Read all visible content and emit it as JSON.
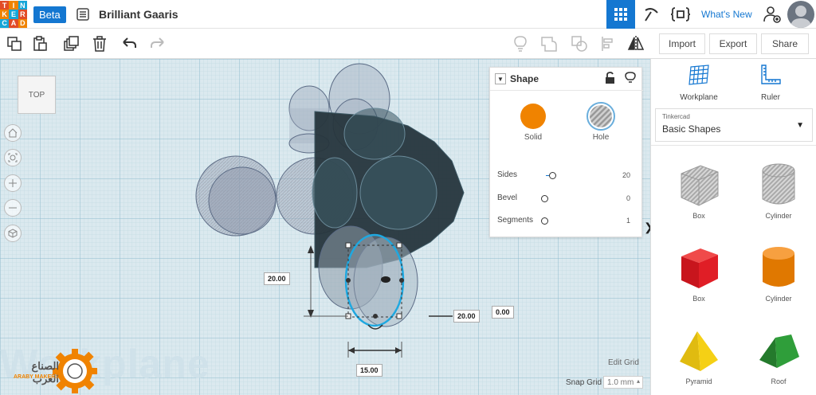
{
  "app": {
    "logo_letters": [
      "T",
      "I",
      "N",
      "K",
      "E",
      "R",
      "C",
      "A",
      "D"
    ],
    "badge": "Beta",
    "project_title": "Brilliant Gaaris"
  },
  "topbar": {
    "whats_new": "What's New"
  },
  "toolbar": {
    "import": "Import",
    "export": "Export",
    "share": "Share"
  },
  "canvas": {
    "view_label": "TOP",
    "workplane_text": "Workplane",
    "watermark": "الصناع العرب",
    "watermark_sub": "ARABY MAKERS"
  },
  "dimensions": {
    "height": "20.00",
    "offset_x": "20.00",
    "offset_y": "0.00",
    "width": "15.00"
  },
  "shape_panel": {
    "title": "Shape",
    "solid": "Solid",
    "hole": "Hole",
    "params": [
      {
        "label": "Sides",
        "value": "20"
      },
      {
        "label": "Bevel",
        "value": "0"
      },
      {
        "label": "Segments",
        "value": "1"
      }
    ]
  },
  "grid": {
    "edit": "Edit Grid",
    "snap_label": "Snap Grid",
    "snap_value": "1.0 mm"
  },
  "sidebar": {
    "workplane": "Workplane",
    "ruler": "Ruler",
    "library_source": "Tinkercad",
    "library_name": "Basic Shapes",
    "shapes": [
      "Box",
      "Cylinder",
      "Box",
      "Cylinder",
      "Pyramid",
      "Roof"
    ]
  },
  "colors": {
    "accent": "#1477d1",
    "solid": "#f0821e",
    "box_red": "#e01e26",
    "cylinder_orange": "#f08300",
    "pyramid_yellow": "#f5d015",
    "roof_green": "#2f9e3a"
  }
}
